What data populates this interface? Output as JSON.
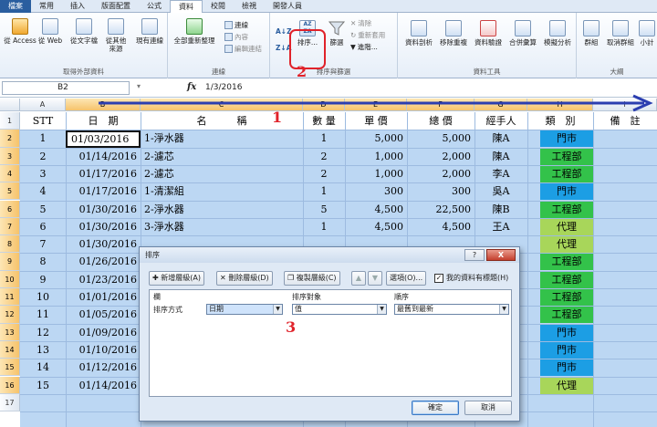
{
  "ribbon": {
    "tabs": [
      "檔案",
      "常用",
      "插入",
      "版面配置",
      "公式",
      "資料",
      "校閱",
      "檢視",
      "開發人員"
    ],
    "active_tab": "資料",
    "groups": {
      "external": {
        "label": "取得外部資料",
        "buttons": [
          "從 Access",
          "從 Web",
          "從文字檔",
          "從其他\n來源",
          "現有連線"
        ]
      },
      "connections": {
        "label": "連線",
        "refresh": "全部重新整理",
        "items": [
          "連線",
          "內容",
          "編輯連結"
        ]
      },
      "sort_filter": {
        "label": "排序與篩選",
        "sort": "排序...",
        "filter": "篩選",
        "clear": "清除",
        "reapply": "重新套用",
        "advanced": "進階..."
      },
      "data_tools": {
        "label": "資料工具",
        "buttons": [
          "資料剖析",
          "移除重複",
          "資料驗證",
          "合併彙算",
          "模擬分析"
        ]
      },
      "outline": {
        "label": "大綱",
        "buttons": [
          "群組",
          "取消群組",
          "小計"
        ]
      }
    }
  },
  "formula_bar": {
    "name_box": "B2",
    "fx": "fx",
    "value": "1/3/2016"
  },
  "annotations": {
    "one": "1",
    "two": "2",
    "three": "3"
  },
  "grid": {
    "columns": [
      "A",
      "B",
      "C",
      "D",
      "E",
      "F",
      "G",
      "H",
      "I"
    ],
    "rows": [
      "1",
      "2",
      "3",
      "4",
      "5",
      "6",
      "7",
      "8",
      "9",
      "10",
      "11",
      "12",
      "13",
      "14",
      "15",
      "16",
      "17"
    ],
    "headers": [
      "STT",
      "日　期",
      "名　　　稱",
      "數 量",
      "單 價",
      "總 價",
      "經手人",
      "類　別",
      "備　註"
    ],
    "data": [
      [
        "1",
        "01/03/2016",
        "1-淨水器",
        "1",
        "5,000",
        "5,000",
        "陳A",
        "門市"
      ],
      [
        "2",
        "01/14/2016",
        "2-濾芯",
        "2",
        "1,000",
        "2,000",
        "陳A",
        "工程部"
      ],
      [
        "3",
        "01/17/2016",
        "2-濾芯",
        "2",
        "1,000",
        "2,000",
        "李A",
        "工程部"
      ],
      [
        "4",
        "01/17/2016",
        "1-清潔組",
        "1",
        "300",
        "300",
        "吳A",
        "門市"
      ],
      [
        "5",
        "01/30/2016",
        "2-淨水器",
        "5",
        "4,500",
        "22,500",
        "陳B",
        "工程部"
      ],
      [
        "6",
        "01/30/2016",
        "3-淨水器",
        "1",
        "4,500",
        "4,500",
        "王A",
        "代理"
      ],
      [
        "7",
        "01/30/2016",
        "",
        "",
        "",
        "",
        "",
        "代理"
      ],
      [
        "8",
        "01/26/2016",
        "",
        "",
        "",
        "",
        "",
        "工程部"
      ],
      [
        "9",
        "01/23/2016",
        "",
        "",
        "",
        "",
        "",
        "工程部"
      ],
      [
        "10",
        "01/01/2016",
        "",
        "",
        "",
        "",
        "",
        "工程部"
      ],
      [
        "11",
        "01/05/2016",
        "",
        "",
        "",
        "",
        "",
        "工程部"
      ],
      [
        "12",
        "01/09/2016",
        "",
        "",
        "",
        "",
        "",
        "門市"
      ],
      [
        "13",
        "01/10/2016",
        "",
        "",
        "",
        "",
        "",
        "門市"
      ],
      [
        "14",
        "01/12/2016",
        "",
        "",
        "",
        "",
        "",
        "門市"
      ],
      [
        "15",
        "01/14/2016",
        "",
        "",
        "",
        "",
        "",
        "代理"
      ]
    ],
    "dept_colors": {
      "門市": "#1c9ee4",
      "工程部": "#33c24a",
      "代理": "#a8d65a"
    }
  },
  "dialog": {
    "title": "排序",
    "help": "?",
    "close": "X",
    "add_level": "新增層級(A)",
    "delete_level": "刪除層級(D)",
    "copy_level": "複製層級(C)",
    "options": "選項(O)...",
    "has_headers": "我的資料有標題(H)",
    "col_header": "欄",
    "sort_on_header": "排序對象",
    "order_header": "順序",
    "sort_by_label": "排序方式",
    "sort_by_value": "日期",
    "sort_on_value": "值",
    "order_value": "最舊到最新",
    "ok": "確定",
    "cancel": "取消"
  }
}
